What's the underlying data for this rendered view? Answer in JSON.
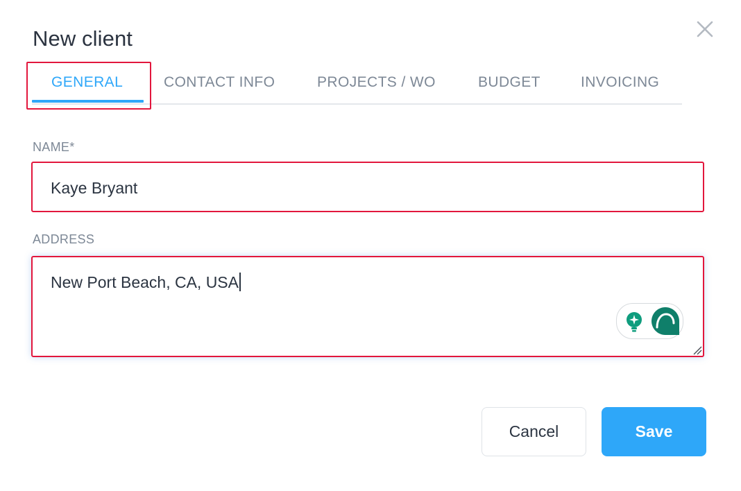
{
  "dialog": {
    "title": "New client",
    "close_icon": "close-icon"
  },
  "tabs": [
    {
      "label": "GENERAL",
      "active": true
    },
    {
      "label": "CONTACT INFO",
      "active": false
    },
    {
      "label": "PROJECTS / WO",
      "active": false
    },
    {
      "label": "BUDGET",
      "active": false
    },
    {
      "label": "INVOICING",
      "active": false
    }
  ],
  "form": {
    "name_label": "NAME*",
    "name_value": "Kaye Bryant",
    "address_label": "ADDRESS",
    "address_value": "New Port Beach, CA, USA"
  },
  "actions": {
    "cancel_label": "Cancel",
    "save_label": "Save"
  },
  "colors": {
    "accent": "#2ea7f9",
    "highlight": "#e2163c",
    "grammar_green": "#0f7f6a"
  },
  "icons": {
    "grammar_suggest": "lightbulb-sparkle-icon",
    "grammar_logo": "grammarly-g-icon"
  }
}
